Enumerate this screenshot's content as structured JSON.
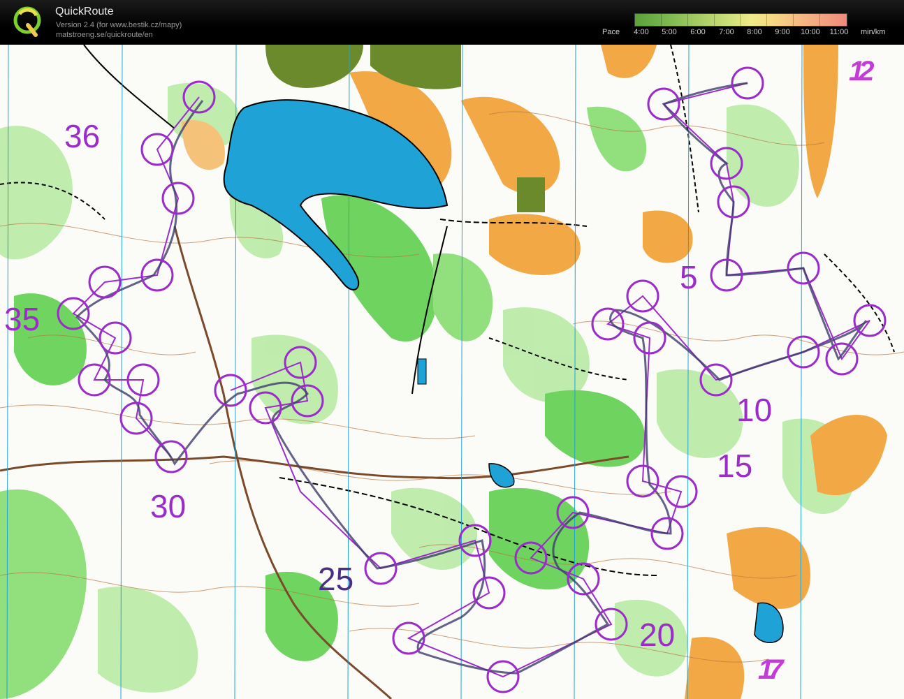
{
  "app": {
    "title": "QuickRoute",
    "version": "Version 2.4  (for www.bestik.cz/mapy)",
    "url": "matstroeng.se/quickroute/en"
  },
  "pace": {
    "label": "Pace",
    "ticks": [
      "4:00",
      "5:00",
      "6:00",
      "7:00",
      "8:00",
      "9:00",
      "10:00",
      "11:00"
    ],
    "unit": "min/km",
    "colors": [
      "#5aa13a",
      "#a6cc63",
      "#f0ea8a",
      "#f5b583",
      "#f08a7e"
    ]
  },
  "map": {
    "control_numbers": [
      "5",
      "10",
      "15",
      "20",
      "25",
      "30",
      "35",
      "36"
    ],
    "overlap_labels": [
      "12",
      "17"
    ],
    "colors": {
      "course": "#9b2cc9",
      "route": "#3d3d6b",
      "water": "#1fa3d6",
      "open": "#f2a945",
      "forest_green": "#5fcf4f",
      "light_green": "#b9eaa5",
      "contour": "#b8763f",
      "settlement": "#6b8a2c"
    }
  }
}
